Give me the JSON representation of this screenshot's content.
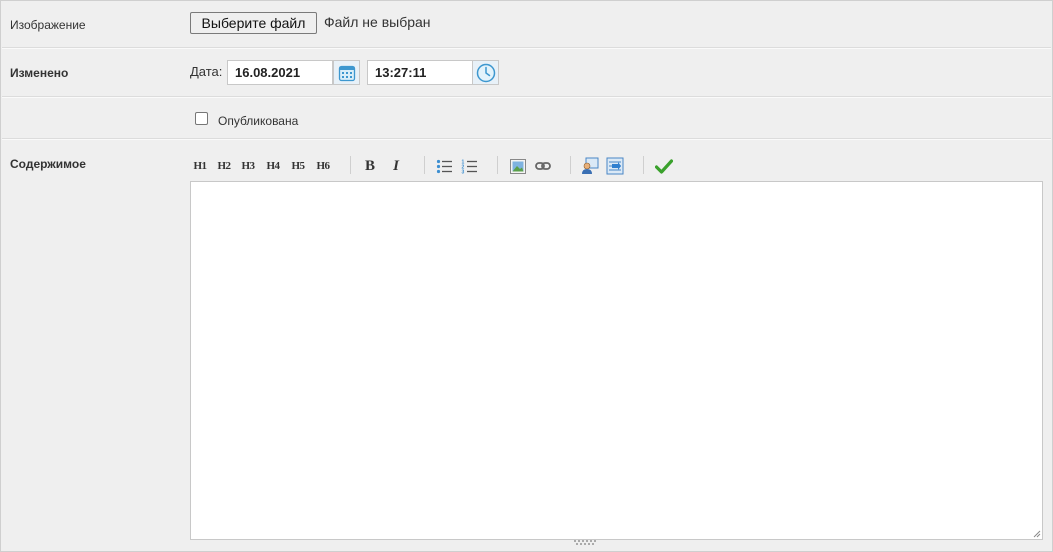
{
  "image_row": {
    "label": "Изображение",
    "choose_button": "Выберите файл",
    "file_status": "Файл не выбран"
  },
  "changed_row": {
    "label": "Изменено",
    "date_label": "Дата:",
    "date_value": "16.08.2021",
    "time_value": "13:27:11",
    "calendar_icon": "calendar-icon",
    "clock_icon": "clock-icon"
  },
  "published_row": {
    "label": "Опубликована",
    "checked": false
  },
  "content_row": {
    "label": "Содержимое",
    "toolbar": {
      "headings": [
        "H1",
        "H2",
        "H3",
        "H4",
        "H5",
        "H6"
      ],
      "bold": "B",
      "italic": "I",
      "icons": [
        "unordered-list-icon",
        "ordered-list-icon",
        "image-icon",
        "link-icon",
        "insert-user-icon",
        "insert-template-icon",
        "checkmark-icon"
      ]
    },
    "editor_text": ""
  },
  "colors": {
    "background": "#efefef",
    "accent": "#4aa3d8",
    "check": "#3aa12c"
  }
}
